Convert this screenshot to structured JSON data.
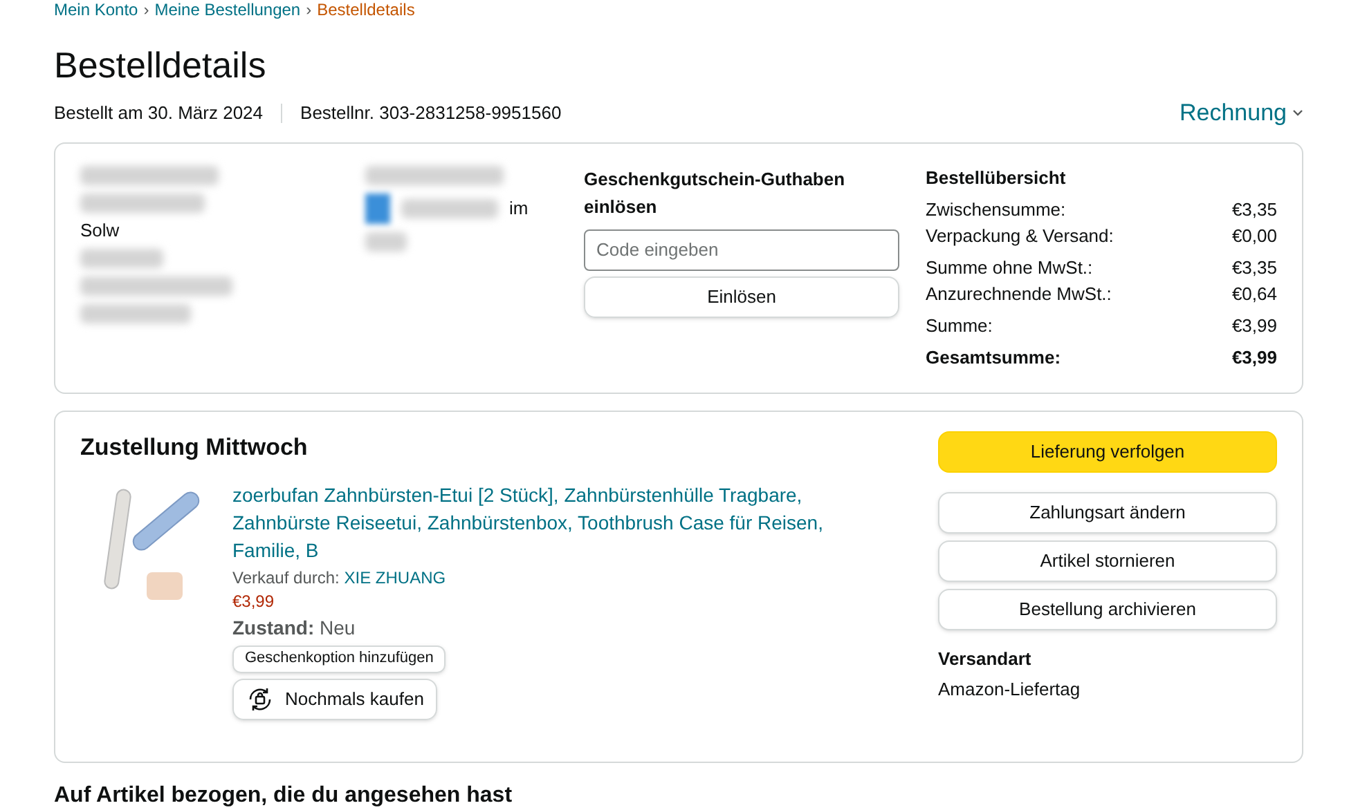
{
  "breadcrumb": [
    {
      "label": "Mein Konto",
      "selected": false
    },
    {
      "label": "Meine Bestellungen",
      "selected": false
    },
    {
      "label": "Bestelldetails",
      "selected": true
    }
  ],
  "breadcrumb_separator": "›",
  "title": "Bestelldetails",
  "order_date": "Bestellt am 30. März 2024",
  "order_number": "Bestellnr. 303-2831258-9951560",
  "invoice_link": "Rechnung",
  "address_fragment": "Solw",
  "payment_fragment": "im",
  "gift_card": {
    "title": "Geschenkgutschein-Guthaben einlösen",
    "placeholder": "Code eingeben",
    "button": "Einlösen"
  },
  "summary": {
    "title": "Bestellübersicht",
    "groups": [
      [
        {
          "label": "Zwischensumme:",
          "value": "€3,35",
          "bold": false
        },
        {
          "label": "Verpackung & Versand:",
          "value": "€0,00",
          "bold": false
        }
      ],
      [
        {
          "label": "Summe ohne MwSt.:",
          "value": "€3,35",
          "bold": false
        },
        {
          "label": "Anzurechnende MwSt.:",
          "value": "€0,64",
          "bold": false
        }
      ],
      [
        {
          "label": "Summe:",
          "value": "€3,99",
          "bold": false
        }
      ],
      [
        {
          "label": "Gesamtsumme:",
          "value": "€3,99",
          "bold": true
        }
      ]
    ]
  },
  "shipment": {
    "title": "Zustellung Mittwoch",
    "item": {
      "name": "zoerbufan Zahnbürsten-Etui [2 Stück], Zahnbürstenhülle Tragbare, Zahnbürste Reiseetui, Zahnbürstenbox, Toothbrush Case für Reisen, Familie, B",
      "seller_label": "Verkauf durch:",
      "seller": "XIE ZHUANG",
      "price": "€3,99",
      "condition_label": "Zustand:",
      "condition": "Neu",
      "gift_button": "Geschenkoption hinzufügen",
      "buy_again": "Nochmals kaufen"
    },
    "actions": [
      {
        "label": "Lieferung verfolgen",
        "kind": "primary"
      },
      {
        "label": "Zahlungsart ändern",
        "kind": "secondary"
      },
      {
        "label": "Artikel stornieren",
        "kind": "secondary"
      },
      {
        "label": "Bestellung archivieren",
        "kind": "secondary"
      }
    ],
    "shipping_title": "Versandart",
    "shipping_value": "Amazon-Liefertag"
  },
  "bottom_heading": "Auf Artikel bezogen, die du angesehen hast"
}
